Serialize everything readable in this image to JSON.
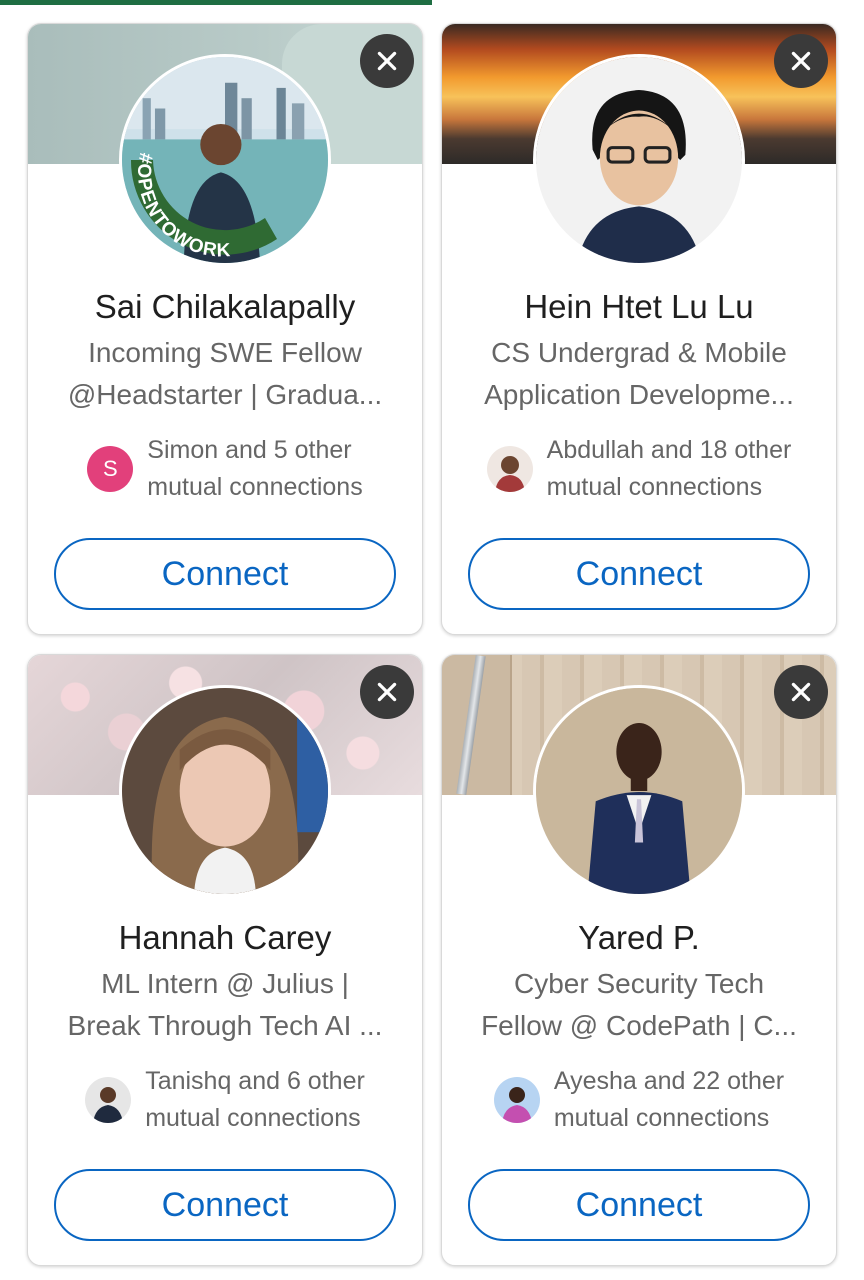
{
  "colors": {
    "brand_blue": "#0a66c2",
    "progress_green": "#1f6e43",
    "open_to_work_green": "#2f6a33",
    "dismiss_bg": "#3a3a3a"
  },
  "icons": {
    "dismiss": "close-icon"
  },
  "cards": [
    {
      "name": "Sai Chilakalapally",
      "headline_line1": "Incoming SWE Fellow",
      "headline_line2": "@Headstarter | Gradua...",
      "open_to_work_badge": "#OPENTOWORK",
      "mutual_avatar_letter": "S",
      "mutual_line1": "Simon and 5 other",
      "mutual_line2": "mutual connections",
      "connect_label": "Connect"
    },
    {
      "name": "Hein Htet Lu Lu",
      "headline_line1": "CS Undergrad & Mobile",
      "headline_line2": "Application Developme...",
      "mutual_line1": "Abdullah and 18 other",
      "mutual_line2": "mutual connections",
      "connect_label": "Connect"
    },
    {
      "name": "Hannah Carey",
      "headline_line1": "ML Intern @ Julius |",
      "headline_line2": "Break Through Tech AI ...",
      "mutual_line1": "Tanishq and 6 other",
      "mutual_line2": "mutual connections",
      "connect_label": "Connect"
    },
    {
      "name": "Yared P.",
      "headline_line1": "Cyber Security Tech",
      "headline_line2": "Fellow @ CodePath | C...",
      "mutual_line1": "Ayesha and 22 other",
      "mutual_line2": "mutual connections",
      "connect_label": "Connect"
    }
  ]
}
